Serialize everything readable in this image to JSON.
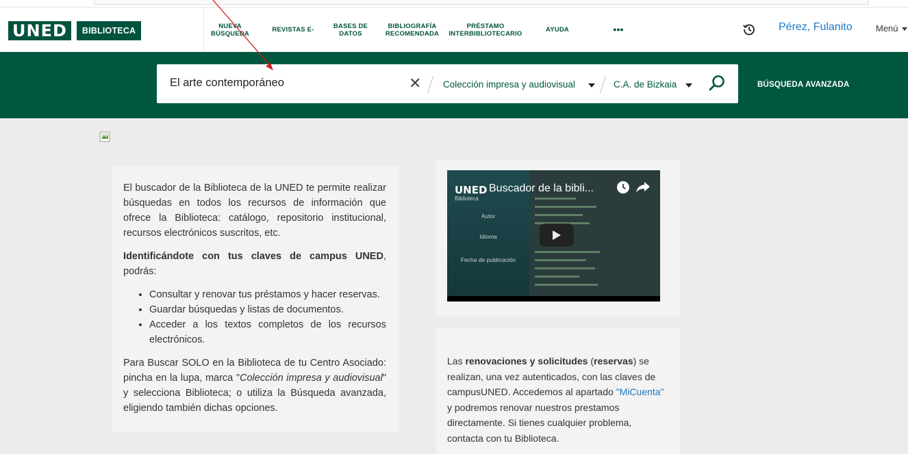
{
  "header": {
    "logo_uned": "UNED",
    "logo_biblioteca": "BIBLIOTECA",
    "nav": [
      {
        "line1": "NUEVA",
        "line2": "BÚSQUEDA"
      },
      {
        "line1": "REVISTAS E-",
        "line2": ""
      },
      {
        "line1": "BASES DE",
        "line2": "DATOS"
      },
      {
        "line1": "BIBLIOGRAFÍA",
        "line2": "RECOMENDADA"
      },
      {
        "line1": "PRÉSTAMO",
        "line2": "INTERBIBLIOTECARIO"
      },
      {
        "line1": "AYUDA",
        "line2": ""
      }
    ],
    "more_label": "•••",
    "history_icon": "history-icon",
    "user_name": "Pérez, Fulanito",
    "menu_label": "Menú"
  },
  "search": {
    "query": "El arte contemporáneo",
    "clear_label": "✕",
    "scope_selected": "Colección impresa y audiovisual",
    "library_selected": "C.A. de Bizkaia",
    "advanced_label": "BÚSQUEDA AVANZADA"
  },
  "info": {
    "p1": "El buscador de la Biblioteca de la UNED te permite realizar búsquedas en todos los recursos de información que ofrece la Biblioteca: catálogo, repositorio institucional, recursos electrónicos suscritos, etc.",
    "p2_bold": "Identificándote con tus claves de campus UNED",
    "p2_rest": ", podrás:",
    "bullets": [
      "Consultar y renovar tus préstamos y hacer reservas.",
      "Guardar búsquedas y listas de documentos.",
      "Acceder a los textos completos de los recursos electrónicos."
    ],
    "p3_a": "Para Buscar SOLO en la Biblioteca de tu Centro Asociado: pincha en la lupa, marca \"",
    "p3_italic": "Colección impresa y audiovisual",
    "p3_b": "\" y selecciona Biblioteca; o utiliza la Búsqueda avanzada, eligiendo también dichas opciones."
  },
  "video": {
    "logo": "UNED",
    "logo_sub": "Biblioteca",
    "title": "Buscador de la bibli...",
    "fields": [
      "Autor",
      "Idioma",
      "Fecha de publicación"
    ]
  },
  "note": {
    "a": "Las ",
    "bold1": "renovaciones y solicitudes",
    "b": " (",
    "bold2": "reservas",
    "c": ") se realizan, una vez autenticados, con las claves de campusUNED. Accedemos al apartado ",
    "link": "\"MiCuenta\"",
    "d": " y podremos renovar nuestros prestamos directamente. Si tienes cualquier problema, contacta con tu Biblioteca."
  },
  "colors": {
    "brand_green": "#00573f",
    "link_blue": "#1b79c6",
    "annotation_red": "#d21f1f"
  }
}
